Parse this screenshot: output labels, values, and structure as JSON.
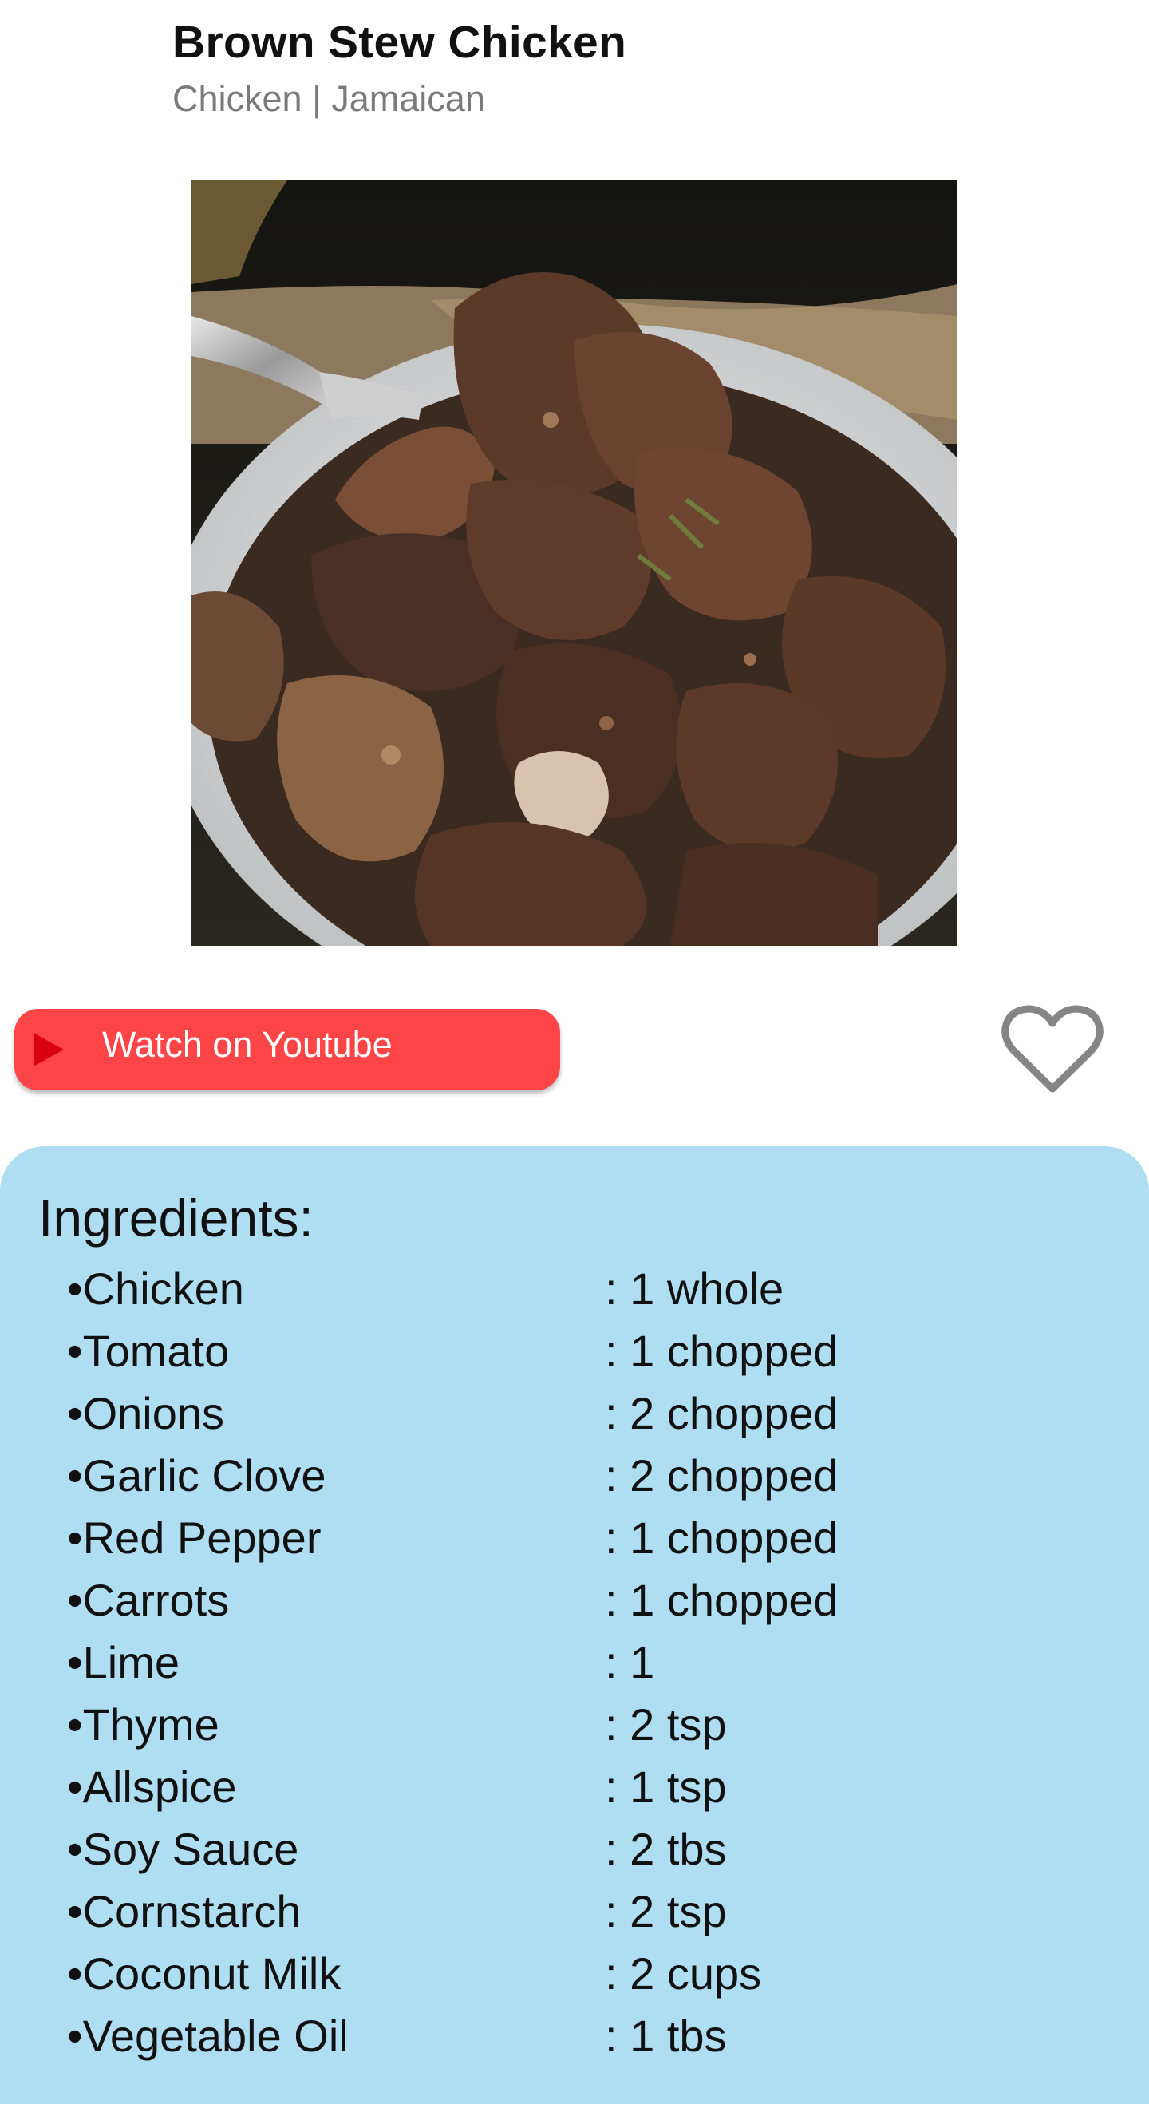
{
  "recipe": {
    "title": "Brown Stew Chicken",
    "subtitle": "Chicken | Jamaican"
  },
  "media": {
    "image_description": "photo of brown stew chicken pieces in a white bowl with a fork"
  },
  "youtube": {
    "label": "Watch on Youtube",
    "icon": "play-icon"
  },
  "favorite": {
    "icon": "heart-outline-icon"
  },
  "ingredients": {
    "title": "Ingredients:",
    "items": [
      {
        "name": "•Chicken",
        "qty": ": 1 whole"
      },
      {
        "name": "•Tomato",
        "qty": ": 1 chopped"
      },
      {
        "name": "•Onions",
        "qty": ": 2 chopped"
      },
      {
        "name": "•Garlic Clove",
        "qty": ": 2 chopped"
      },
      {
        "name": "•Red Pepper",
        "qty": ": 1 chopped"
      },
      {
        "name": "•Carrots",
        "qty": ": 1 chopped"
      },
      {
        "name": "•Lime",
        "qty": ": 1"
      },
      {
        "name": "•Thyme",
        "qty": ": 2 tsp"
      },
      {
        "name": "•Allspice",
        "qty": ": 1 tsp"
      },
      {
        "name": "•Soy Sauce",
        "qty": ": 2 tbs"
      },
      {
        "name": "•Cornstarch",
        "qty": ": 2 tsp"
      },
      {
        "name": "•Coconut Milk",
        "qty": ": 2 cups"
      },
      {
        "name": "•Vegetable Oil",
        "qty": ": 1 tbs"
      }
    ]
  },
  "colors": {
    "youtube_button": "#fd4548",
    "play_icon": "#d9000d",
    "ingredients_bg": "#afdef3",
    "subtitle_text": "#7a7a7a",
    "heart_stroke": "#858585"
  }
}
